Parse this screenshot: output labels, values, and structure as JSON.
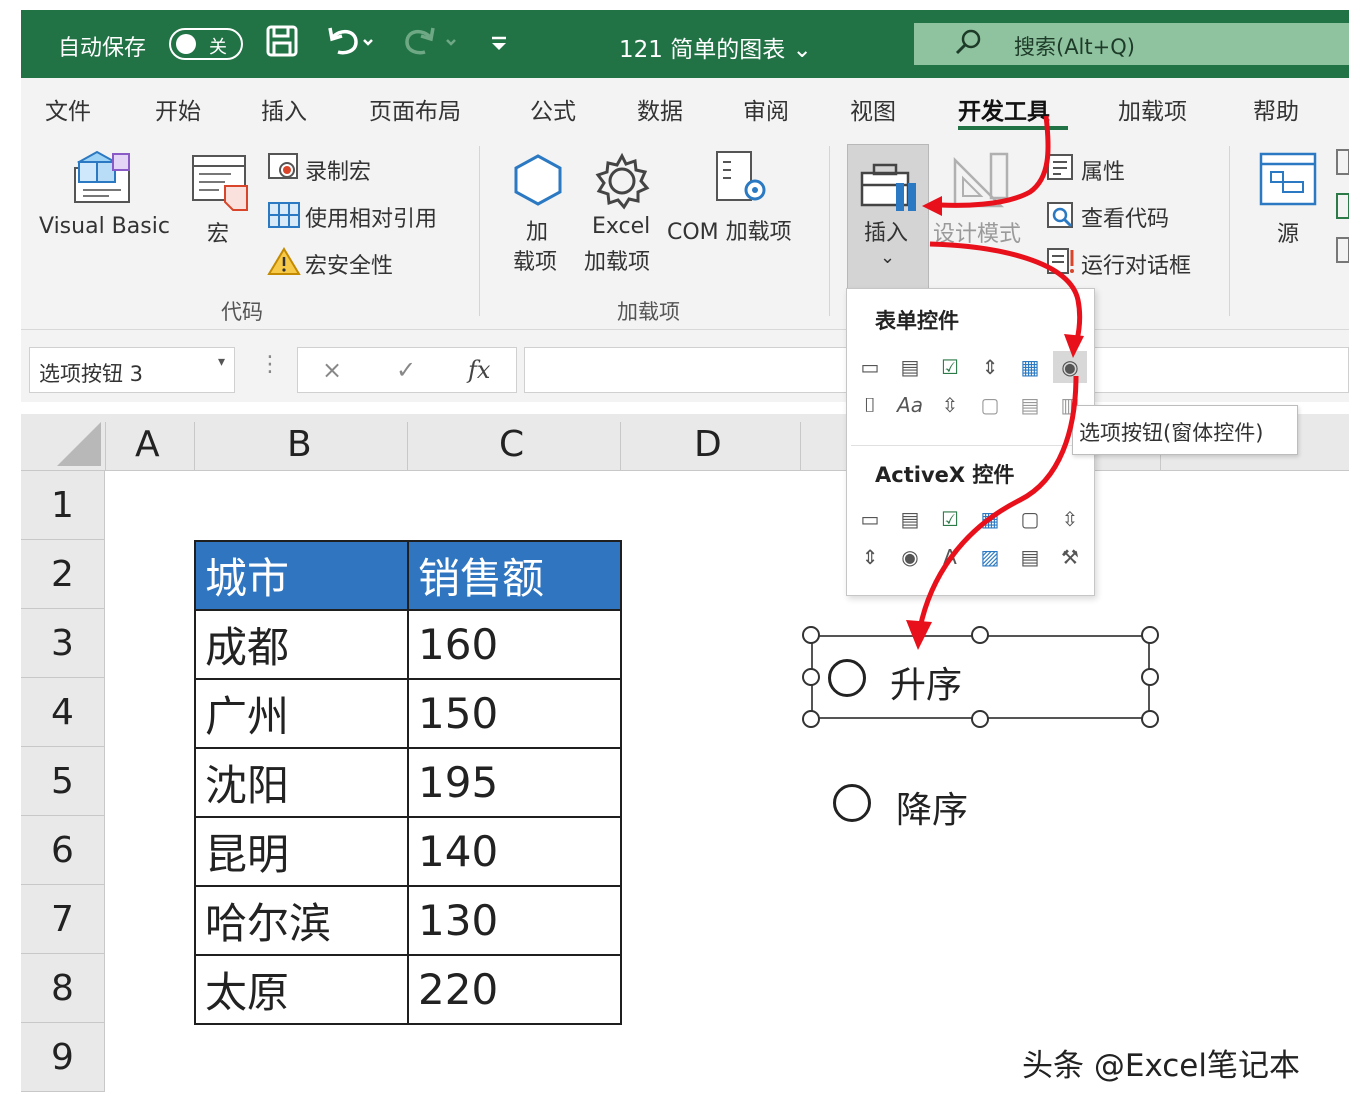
{
  "titlebar": {
    "autosave_label": "自动保存",
    "autosave_state": "关",
    "doc_title": "121 简单的图表 ⌄",
    "search_placeholder": "搜索(Alt+Q)"
  },
  "tabs": [
    "文件",
    "开始",
    "插入",
    "页面布局",
    "公式",
    "数据",
    "审阅",
    "视图",
    "开发工具",
    "加载项",
    "帮助"
  ],
  "active_tab": "开发工具",
  "ribbon": {
    "code_group": {
      "label": "代码",
      "visual_basic": "Visual Basic",
      "macros": "宏",
      "record_macro": "录制宏",
      "relative_refs": "使用相对引用",
      "macro_security": "宏安全性"
    },
    "addins_group": {
      "label": "加载项",
      "addins_line1": "加",
      "addins_line2": "载项",
      "excel_addins_line1": "Excel",
      "excel_addins_line2": "加载项",
      "com_addins": "COM 加载项"
    },
    "controls_group": {
      "insert": "插入",
      "insert_caret": "⌄",
      "design_mode": "设计模式",
      "properties": "属性",
      "view_code": "查看代码",
      "run_dialog": "运行对话框"
    },
    "xml_group": {
      "source": "源"
    }
  },
  "formula_bar": {
    "name_box": "选项按钮 3",
    "cancel": "×",
    "enter": "✓",
    "fx": "fx",
    "content": ""
  },
  "grid": {
    "columns": [
      "A",
      "B",
      "C",
      "D"
    ],
    "rows": [
      "1",
      "2",
      "3",
      "4",
      "5",
      "6",
      "7",
      "8",
      "9"
    ]
  },
  "table": {
    "headers": [
      "城市",
      "销售额"
    ],
    "rows": [
      [
        "成都",
        "160"
      ],
      [
        "广州",
        "150"
      ],
      [
        "沈阳",
        "195"
      ],
      [
        "昆明",
        "140"
      ],
      [
        "哈尔滨",
        "130"
      ],
      [
        "太原",
        "220"
      ]
    ],
    "header_color": "#2f75c0"
  },
  "option_buttons": [
    {
      "label": "升序",
      "selected_for_edit": true
    },
    {
      "label": "降序",
      "selected_for_edit": false
    }
  ],
  "insert_dropdown": {
    "form_controls_heading": "表单控件",
    "activex_heading": "ActiveX 控件",
    "tooltip": "选项按钮(窗体控件)",
    "highlighted_control": "option-button-icon"
  },
  "colors": {
    "excel_green": "#217346",
    "arrow_red": "#e8101a"
  },
  "watermark": "头条 @Excel笔记本"
}
